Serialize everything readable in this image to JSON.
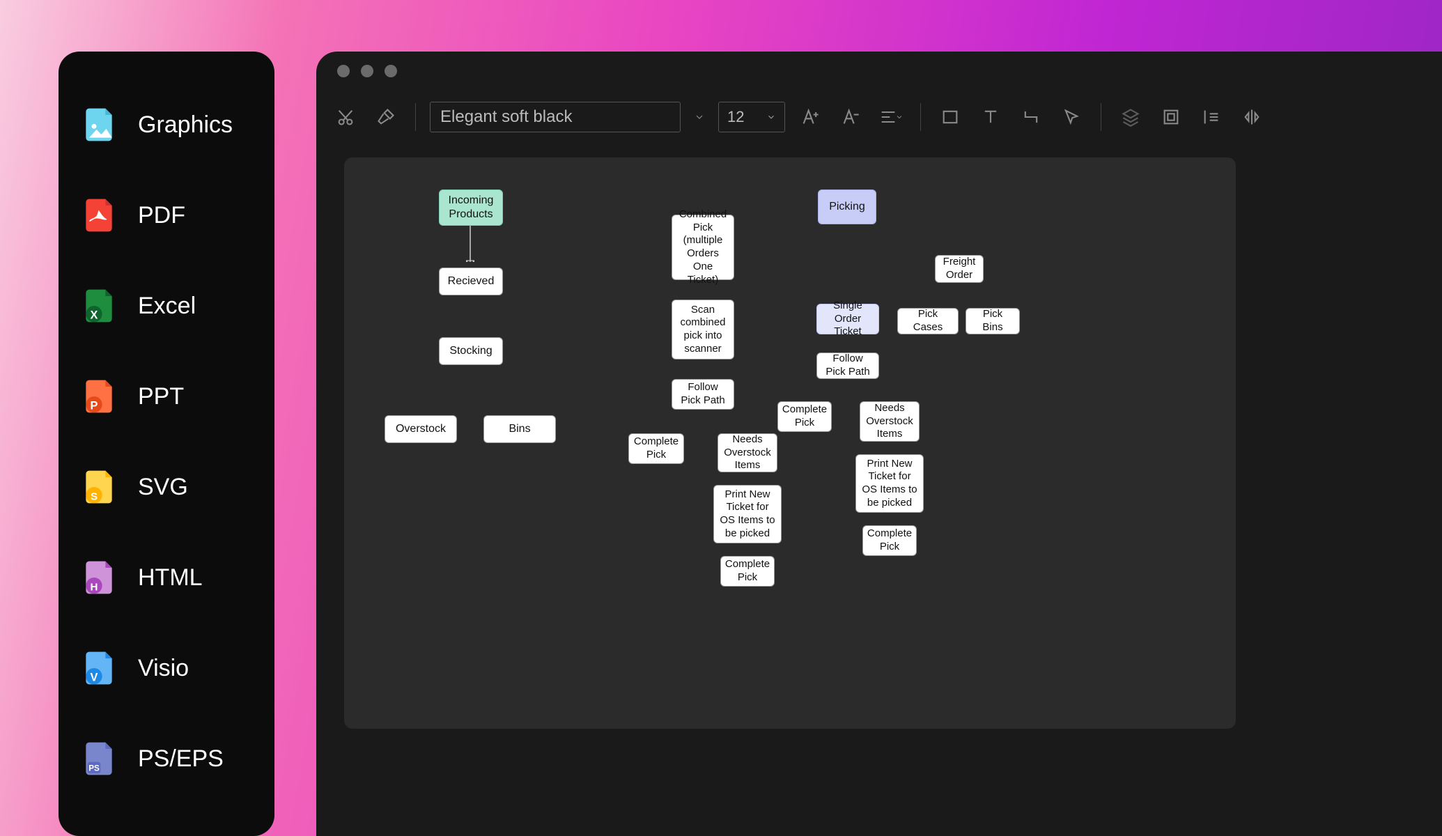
{
  "sidebar": {
    "items": [
      {
        "label": "Graphics",
        "icon": "graphics"
      },
      {
        "label": "PDF",
        "icon": "pdf"
      },
      {
        "label": "Excel",
        "icon": "excel"
      },
      {
        "label": "PPT",
        "icon": "ppt"
      },
      {
        "label": "SVG",
        "icon": "svg"
      },
      {
        "label": "HTML",
        "icon": "html"
      },
      {
        "label": "Visio",
        "icon": "visio"
      },
      {
        "label": "PS/EPS",
        "icon": "pseps"
      }
    ]
  },
  "toolbar": {
    "font_name": "Elegant soft black",
    "font_size": "12"
  },
  "flowchart": {
    "nodes": {
      "incoming": "Incoming Products",
      "received": "Recieved",
      "stocking": "Stocking",
      "overstock": "Overstock",
      "bins": "Bins",
      "picking": "Picking",
      "combined": "Combined Pick (multiple Orders One Ticket)",
      "scan": "Scan combined pick into scanner",
      "follow1": "Follow Pick Path",
      "complete1": "Complete Pick",
      "needs1": "Needs Overstock Items",
      "print1": "Print New Ticket for OS Items to be picked",
      "complete1b": "Complete Pick",
      "single": "Single Order Ticket",
      "follow2": "Follow Pick Path",
      "complete2": "Complete Pick",
      "needs2": "Needs Overstock Items",
      "print2": "Print New Ticket for OS Items to be picked",
      "complete2b": "Complete Pick",
      "freight": "Freight Order",
      "pickcases": "Pick Cases",
      "pickbins": "Pick Bins"
    }
  }
}
